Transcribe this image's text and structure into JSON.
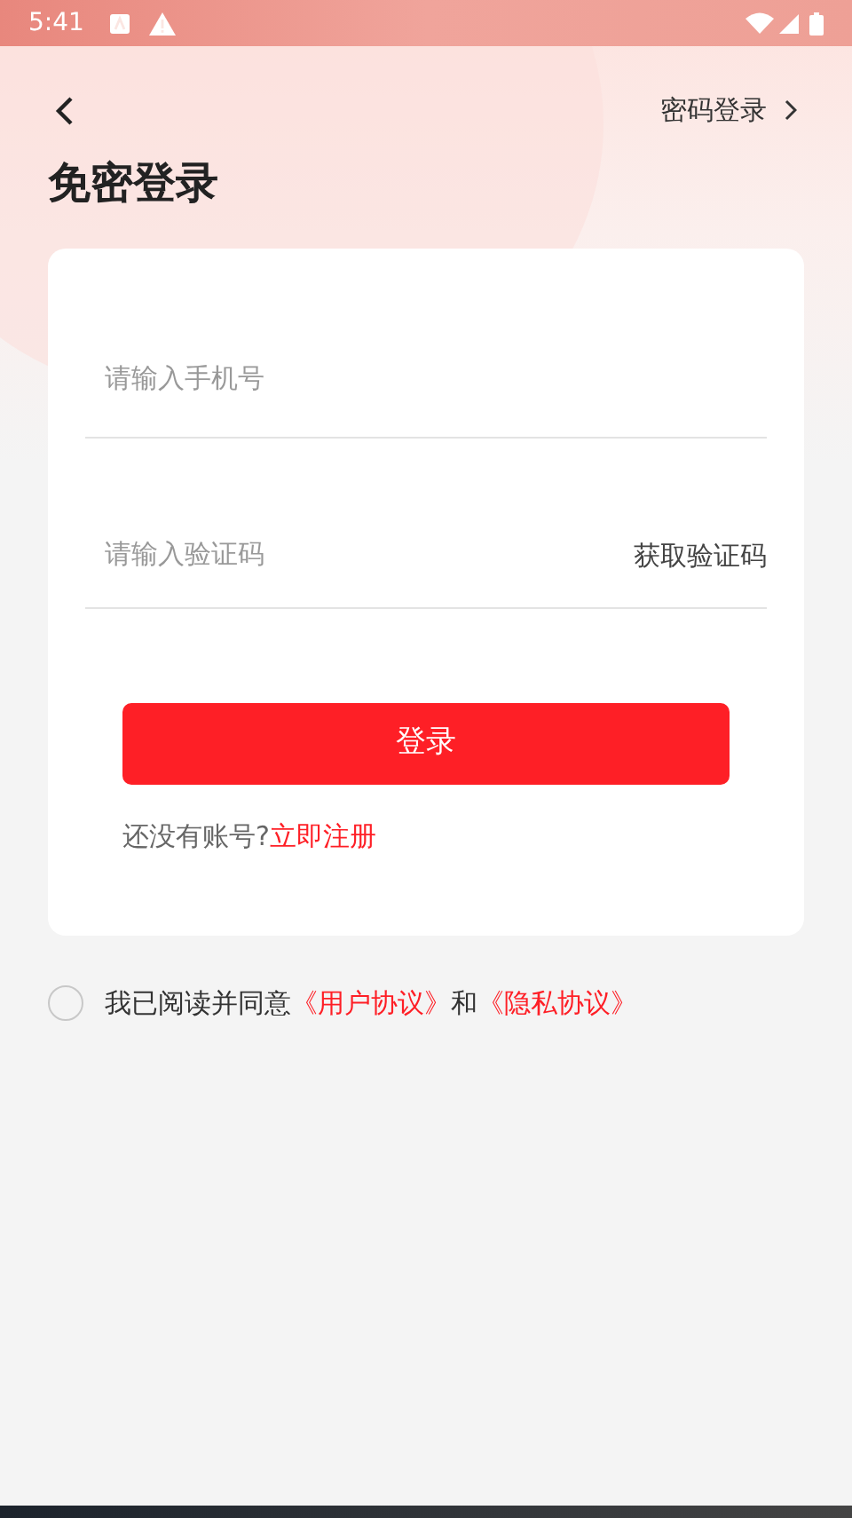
{
  "status_bar": {
    "time": "5:41"
  },
  "header": {
    "password_login": "密码登录"
  },
  "title": "免密登录",
  "form": {
    "phone": {
      "placeholder": "请输入手机号"
    },
    "code": {
      "placeholder": "请输入验证码",
      "get_code": "获取验证码"
    },
    "login_button": "登录",
    "register": [
      {
        "kind": "plain",
        "text": "还没有账号?"
      },
      {
        "kind": "link",
        "text": "立即注册"
      }
    ]
  },
  "agreement": {
    "checked": false,
    "parts": [
      {
        "kind": "plain",
        "text": "我已阅读并同意"
      },
      {
        "kind": "link",
        "text": "《用户协议》"
      },
      {
        "kind": "plain",
        "text": "和"
      },
      {
        "kind": "link",
        "text": "《隐私协议》"
      }
    ]
  }
}
